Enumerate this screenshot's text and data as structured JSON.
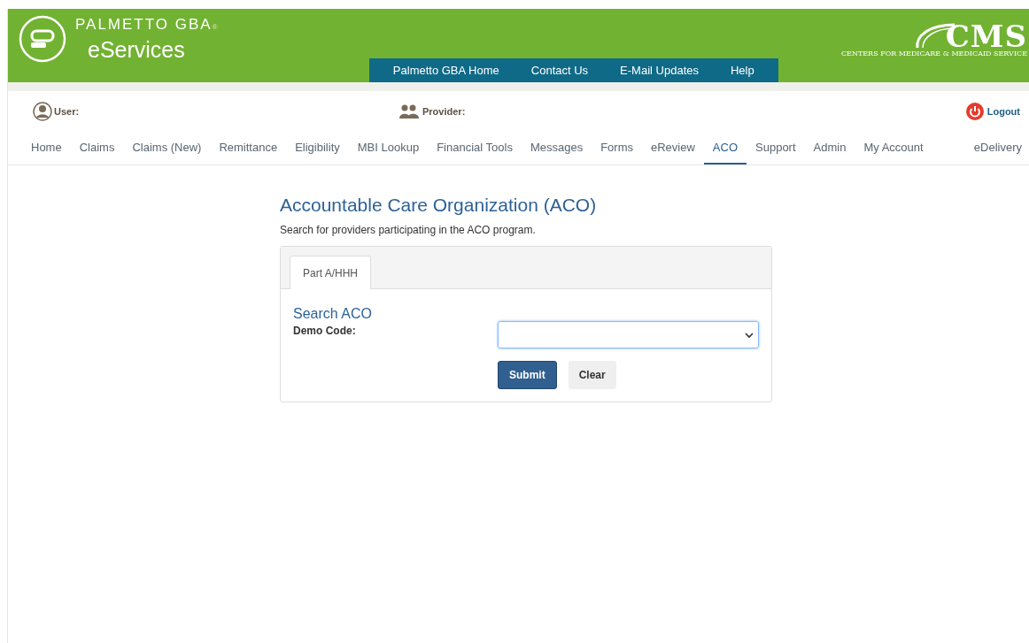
{
  "header": {
    "brand": "PALMETTO GBA",
    "registered": "®",
    "product": "eServices",
    "cms_logo": {
      "letters": "CMS",
      "tagline": "CENTERS FOR MEDICARE & MEDICAID SERVICE"
    }
  },
  "top_links": [
    "Palmetto GBA Home",
    "Contact Us",
    "E-Mail Updates",
    "Help"
  ],
  "user_bar": {
    "user_label": "User:",
    "provider_label": "Provider:",
    "logout": "Logout"
  },
  "nav": [
    {
      "label": "Home",
      "selected": false
    },
    {
      "label": "Claims",
      "selected": false
    },
    {
      "label": "Claims (New)",
      "selected": false
    },
    {
      "label": "Remittance",
      "selected": false
    },
    {
      "label": "Eligibility",
      "selected": false
    },
    {
      "label": "MBI Lookup",
      "selected": false
    },
    {
      "label": "Financial Tools",
      "selected": false
    },
    {
      "label": "Messages",
      "selected": false
    },
    {
      "label": "Forms",
      "selected": false
    },
    {
      "label": "eReview",
      "selected": false
    },
    {
      "label": "ACO",
      "selected": true
    },
    {
      "label": "Support",
      "selected": false
    },
    {
      "label": "Admin",
      "selected": false
    },
    {
      "label": "My Account",
      "selected": false
    },
    {
      "label": "eDelivery",
      "selected": false
    }
  ],
  "page": {
    "title": "Accountable Care Organization (ACO)",
    "subtitle": "Search for providers participating in the ACO program.",
    "tabs": [
      {
        "label": "Part A/HHH",
        "selected": true
      }
    ],
    "form": {
      "heading": "Search ACO",
      "field_label": "Demo Code:",
      "buttons": [
        "Submit",
        "Clear"
      ]
    }
  }
}
